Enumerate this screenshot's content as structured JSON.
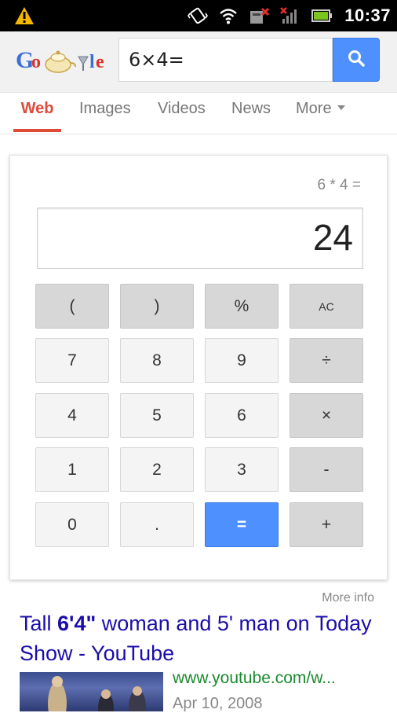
{
  "status_bar": {
    "time": "10:37",
    "icons": [
      "warning-icon",
      "vibrate-icon",
      "wifi-icon",
      "data-off-icon",
      "no-signal-icon",
      "battery-icon"
    ]
  },
  "search": {
    "query": "6×4=",
    "button_icon": "search-icon"
  },
  "tabs": [
    {
      "label": "Web",
      "active": true
    },
    {
      "label": "Images",
      "active": false
    },
    {
      "label": "Videos",
      "active": false
    },
    {
      "label": "News",
      "active": false
    },
    {
      "label": "More",
      "active": false
    }
  ],
  "calculator": {
    "expression": "6 * 4 =",
    "display": "24",
    "keys": [
      [
        "(",
        ")",
        "%",
        "AC"
      ],
      [
        "7",
        "8",
        "9",
        "÷"
      ],
      [
        "4",
        "5",
        "6",
        "×"
      ],
      [
        "1",
        "2",
        "3",
        "-"
      ],
      [
        "0",
        ".",
        "=",
        "+"
      ]
    ]
  },
  "more_info": "More info",
  "result": {
    "title_part1": "Tall ",
    "title_bold": "6'4\"",
    "title_part2": " woman and 5' man on Today Show - YouTube",
    "url": "www.youtube.com/w...",
    "date": "Apr 10, 2008"
  },
  "colors": {
    "accent_red": "#dd4b39",
    "accent_blue": "#4d90fe",
    "link_blue": "#1a0dab",
    "url_green": "#1b8a2e"
  }
}
